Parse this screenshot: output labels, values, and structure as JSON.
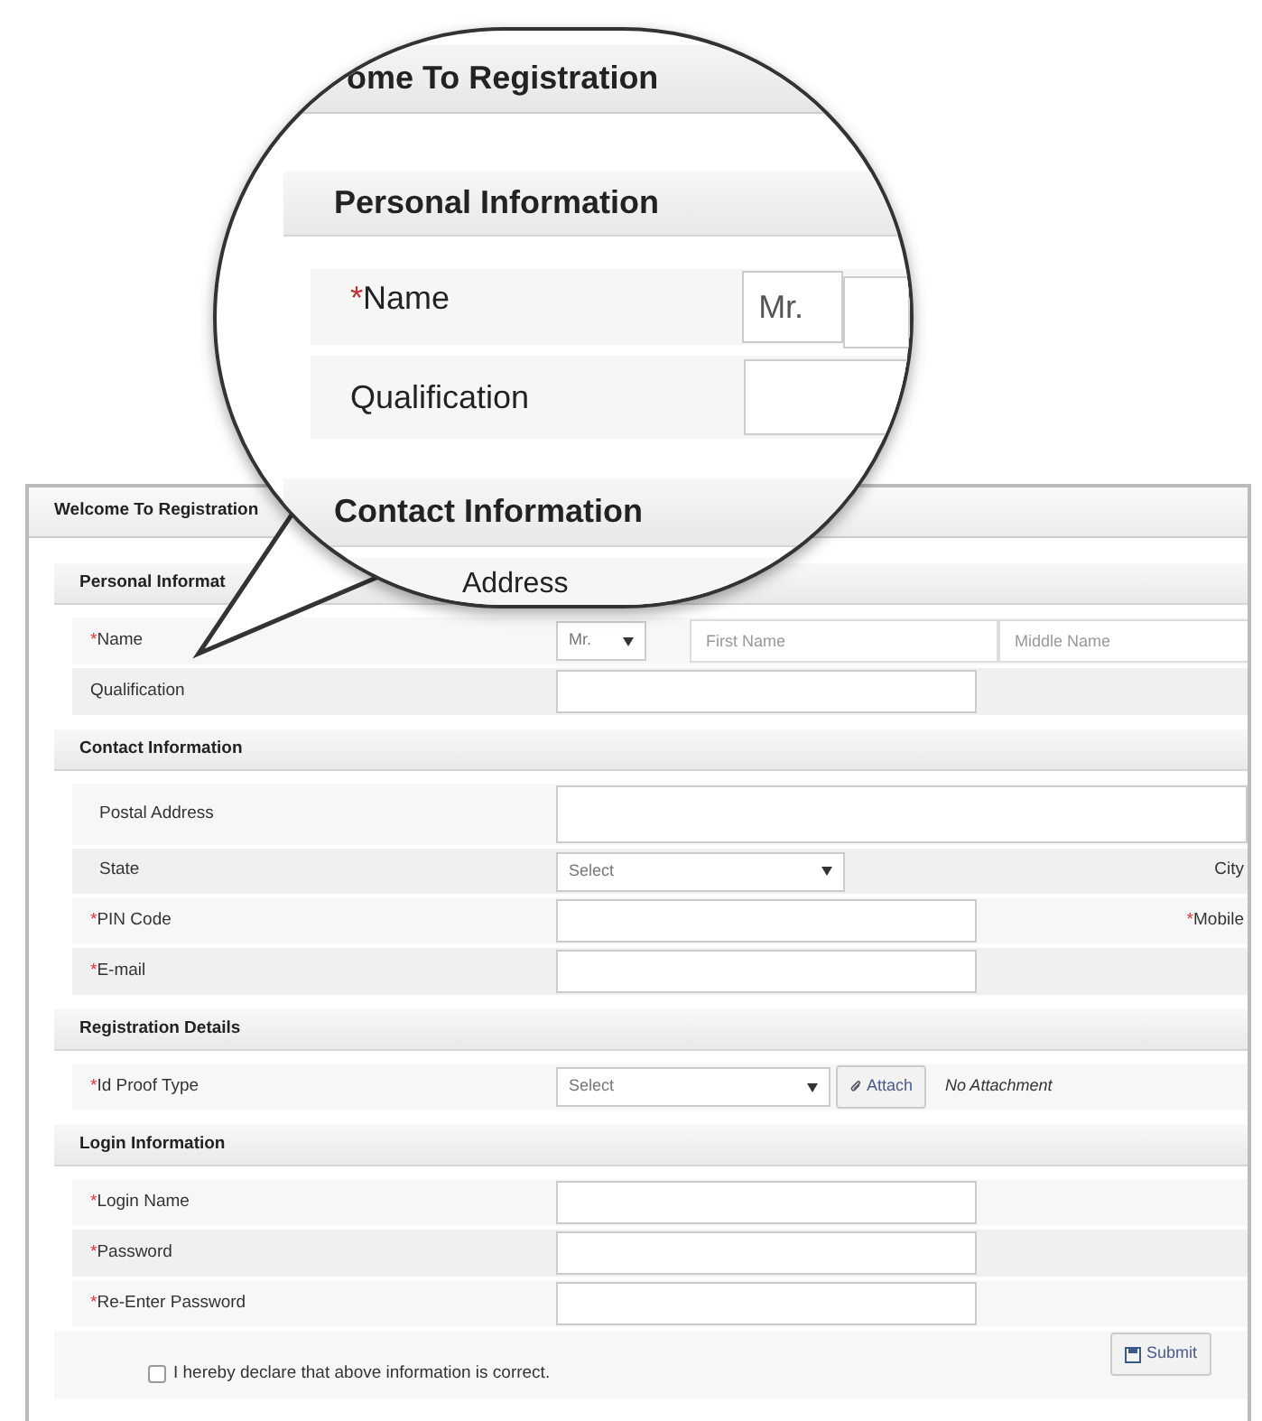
{
  "window": {
    "title": "Welcome To Registration"
  },
  "sections": [
    {
      "title": "Personal Informat",
      "rows": [
        {
          "kind": "name",
          "mark": "*",
          "label": "Name",
          "title_value": "Mr.",
          "placeholders": [
            "First Name",
            "Middle Name"
          ]
        },
        {
          "kind": "text",
          "label": "Qualification"
        }
      ]
    },
    {
      "title": "Contact Information",
      "rows": [
        {
          "kind": "textarea",
          "label": "Postal Address"
        },
        {
          "kind": "select",
          "label": "State",
          "value": "Select",
          "side_label": "City"
        },
        {
          "kind": "text",
          "mark": "*",
          "label": "PIN Code",
          "side_mark": "*",
          "side_label": "Mobile"
        },
        {
          "kind": "text",
          "mark": "*",
          "label": "E-mail"
        }
      ]
    },
    {
      "title": "Registration Details",
      "rows": [
        {
          "kind": "attach",
          "mark": "*",
          "label": "Id Proof Type",
          "value": "Select",
          "button": "Attach",
          "note": "No Attachment"
        }
      ]
    },
    {
      "title": "Login Information",
      "rows": [
        {
          "kind": "text",
          "mark": "*",
          "label": "Login Name"
        },
        {
          "kind": "text",
          "mark": "*",
          "label": "Password"
        },
        {
          "kind": "text",
          "mark": "*",
          "label": "Re-Enter Password"
        }
      ]
    }
  ],
  "declaration": {
    "checked": false,
    "label": "I hereby declare that above information is correct."
  },
  "submit": "Submit",
  "magnifier": {
    "title": "ome To Registration",
    "section": "Personal Information",
    "name_mark": "*",
    "name_label": "Name",
    "title_value": "Mr.",
    "qualification": "Qualification",
    "section_2": "Contact Information",
    "next_label": "Address"
  }
}
